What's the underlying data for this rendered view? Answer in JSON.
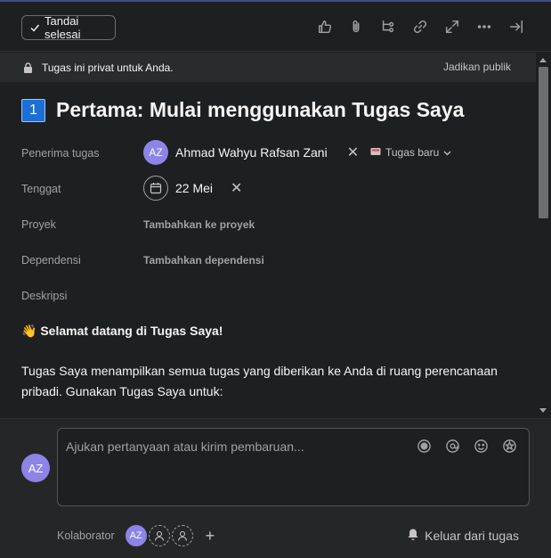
{
  "toolbar": {
    "mark_complete_label": "Tandai selesai",
    "icons": [
      "like-icon",
      "attachment-icon",
      "subtask-icon",
      "link-icon",
      "expand-icon",
      "more-icon",
      "close-pane-icon"
    ]
  },
  "privacy": {
    "message": "Tugas ini privat untuk Anda.",
    "action": "Jadikan publik"
  },
  "task": {
    "number": "1",
    "title": "Pertama: Mulai menggunakan Tugas Saya"
  },
  "fields": {
    "assignee_label": "Penerima tugas",
    "assignee_initials": "AZ",
    "assignee_name": "Ahmad Wahyu Rafsan Zani",
    "section": "Tugas baru",
    "due_label": "Tenggat",
    "due_value": "22 Mei",
    "project_label": "Proyek",
    "project_value": "Tambahkan ke proyek",
    "dependency_label": "Dependensi",
    "dependency_value": "Tambahkan dependensi",
    "description_label": "Deskripsi"
  },
  "description": {
    "emoji": "👋",
    "heading": "Selamat datang di Tugas Saya!",
    "body": "Tugas Saya menampilkan semua tugas yang diberikan ke Anda di ruang perencanaan pribadi. Gunakan Tugas Saya untuk:"
  },
  "comment": {
    "author_initials": "AZ",
    "placeholder": "Ajukan pertanyaan atau kirim pembaruan..."
  },
  "collaborators": {
    "label": "Kolaborator",
    "initials": "AZ",
    "leave_label": "Keluar dari tugas"
  },
  "colors": {
    "background": "#1e1f21",
    "avatar": "#8d84e8",
    "badge": "#1d6fd6"
  }
}
